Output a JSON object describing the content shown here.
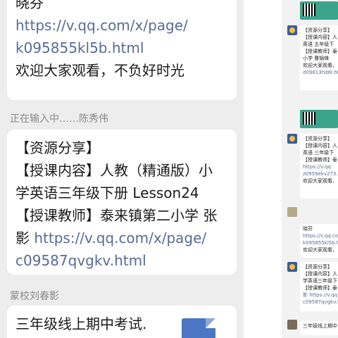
{
  "chat": {
    "bubble1": {
      "name": "晓芬",
      "link": "https://v.qq.com/x/page/k095855kl5b.html",
      "link_line1": "https://v.qq.com/x/page/",
      "link_line2": "k095855kl5b.html",
      "message": "欢迎大家观看，不负好时光"
    },
    "typing_status": "正在输入中……陈秀伟",
    "bubble2": {
      "line1": "【资源分享】",
      "line2": "【授课内容】人教（精通版）小",
      "line3": "学英语三年级下册 Lesson24",
      "line4": "【授课教师】泰来镇第二小学 张",
      "line5_text": "影 ",
      "link_line1": "https://v.qq.com/x/page/",
      "link_line2": "c09587qvgkv.html"
    },
    "sender3": "蒙校刘春影",
    "bubble3": {
      "text": "三年级线上期中考试."
    }
  },
  "thumbs": {
    "card1": [
      "【资源分享】",
      "【授课内容】人",
      "英语 五年级下",
      "【授课教师】泰",
      "小学 曹锦锋",
      "欢迎大家观看，",
      "d09613hd8l.html"
    ],
    "card2": [
      "【资源分享】",
      "【授课内容】人",
      "英语 三年级下",
      "【授课教师】泰",
      "https://v.qq",
      "z0959ekv273.h",
      "欢迎大家观看，"
    ],
    "card3": [
      "晓芬",
      "https://v.qq.co",
      "k095855kl5b.ht",
      "欢迎大家观看，"
    ],
    "card4": [
      "【资源分享】",
      "【授课内容】人",
      "学英语三年级下",
      "【授课教师】泰",
      "影 https://v.qq",
      "c09587qvgkv.h"
    ],
    "card5": [
      "三年级线上期中"
    ]
  },
  "colors": {
    "chat_bg": "#ededed",
    "bubble_bg": "#ffffff",
    "link": "#576b95",
    "meta_text": "#8a8a8a"
  }
}
